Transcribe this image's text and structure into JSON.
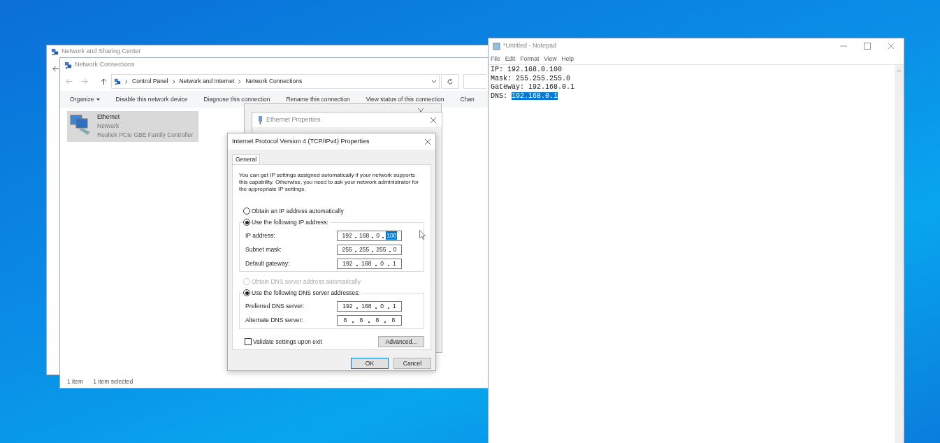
{
  "sharing_center": {
    "title": "Network and Sharing Center"
  },
  "network_connections": {
    "title": "Network Connections",
    "breadcrumb": [
      "Control Panel",
      "Network and Internet",
      "Network Connections"
    ],
    "toolbar": [
      {
        "label": "Organize",
        "menu": true
      },
      {
        "label": "Disable this network device",
        "menu": false
      },
      {
        "label": "Diagnose this connection",
        "menu": false
      },
      {
        "label": "Rename this connection",
        "menu": false
      },
      {
        "label": "View status of this connection",
        "menu": false
      },
      {
        "label": "Chan",
        "menu": false
      }
    ],
    "items": [
      {
        "name": "Ethernet",
        "status": "Network",
        "device": "Realtek PCIe GBE Family Controller",
        "selected": true
      }
    ],
    "status_bar": [
      "1 item",
      "1 item selected"
    ]
  },
  "ethernet_properties": {
    "title": "Ethernet Properties"
  },
  "ipv4_dialog": {
    "title": "Internet Protocol Version 4 (TCP/IPv4) Properties",
    "tabs": [
      {
        "label": "General",
        "selected": true
      }
    ],
    "description": "You can get IP settings assigned automatically if your network supports this capability. Otherwise, you need to ask your network administrator for the appropriate IP settings.",
    "ip_options": [
      {
        "label": "Obtain an IP address automatically",
        "selected": false,
        "disabled": false
      },
      {
        "label": "Use the following IP address:",
        "selected": true,
        "disabled": false
      }
    ],
    "ip_fields": [
      {
        "label": "IP address:",
        "octets": [
          {
            "value": "192",
            "highlighted": false
          },
          {
            "value": "168",
            "highlighted": false
          },
          {
            "value": "0",
            "highlighted": false
          },
          {
            "value": "100",
            "highlighted": true
          }
        ]
      },
      {
        "label": "Subnet mask:",
        "octets": [
          {
            "value": "255",
            "highlighted": false
          },
          {
            "value": "255",
            "highlighted": false
          },
          {
            "value": "255",
            "highlighted": false
          },
          {
            "value": "0",
            "highlighted": false
          }
        ]
      },
      {
        "label": "Default gateway:",
        "octets": [
          {
            "value": "192",
            "highlighted": false
          },
          {
            "value": "168",
            "highlighted": false
          },
          {
            "value": "0",
            "highlighted": false
          },
          {
            "value": "1",
            "highlighted": false
          }
        ]
      }
    ],
    "dns_options": [
      {
        "label": "Obtain DNS server address automatically",
        "selected": false,
        "disabled": true
      },
      {
        "label": "Use the following DNS server addresses:",
        "selected": true,
        "disabled": false
      }
    ],
    "dns_fields": [
      {
        "label": "Preferred DNS server:",
        "octets": [
          {
            "value": "192",
            "highlighted": false
          },
          {
            "value": "168",
            "highlighted": false
          },
          {
            "value": "0",
            "highlighted": false
          },
          {
            "value": "1",
            "highlighted": false
          }
        ]
      },
      {
        "label": "Alternate DNS server:",
        "octets": [
          {
            "value": "8",
            "highlighted": false
          },
          {
            "value": "8",
            "highlighted": false
          },
          {
            "value": "8",
            "highlighted": false
          },
          {
            "value": "8",
            "highlighted": false
          }
        ]
      }
    ],
    "validate": {
      "label": "Validate settings upon exit",
      "checked": false
    },
    "advanced_button": "Advanced...",
    "buttons": [
      {
        "label": "OK",
        "default": true
      },
      {
        "label": "Cancel",
        "default": false
      }
    ]
  },
  "notepad": {
    "title": "*Untitled - Notepad",
    "menu": [
      "File",
      "Edit",
      "Format",
      "View",
      "Help"
    ],
    "lines": [
      {
        "text": "IP: 192.168.0.100"
      },
      {
        "text": "Mask: 255.255.255.0"
      },
      {
        "text": "Gateway: 192.168.0.1"
      },
      {
        "text": "DNS: ",
        "selection": "192.168.0.1"
      }
    ]
  }
}
